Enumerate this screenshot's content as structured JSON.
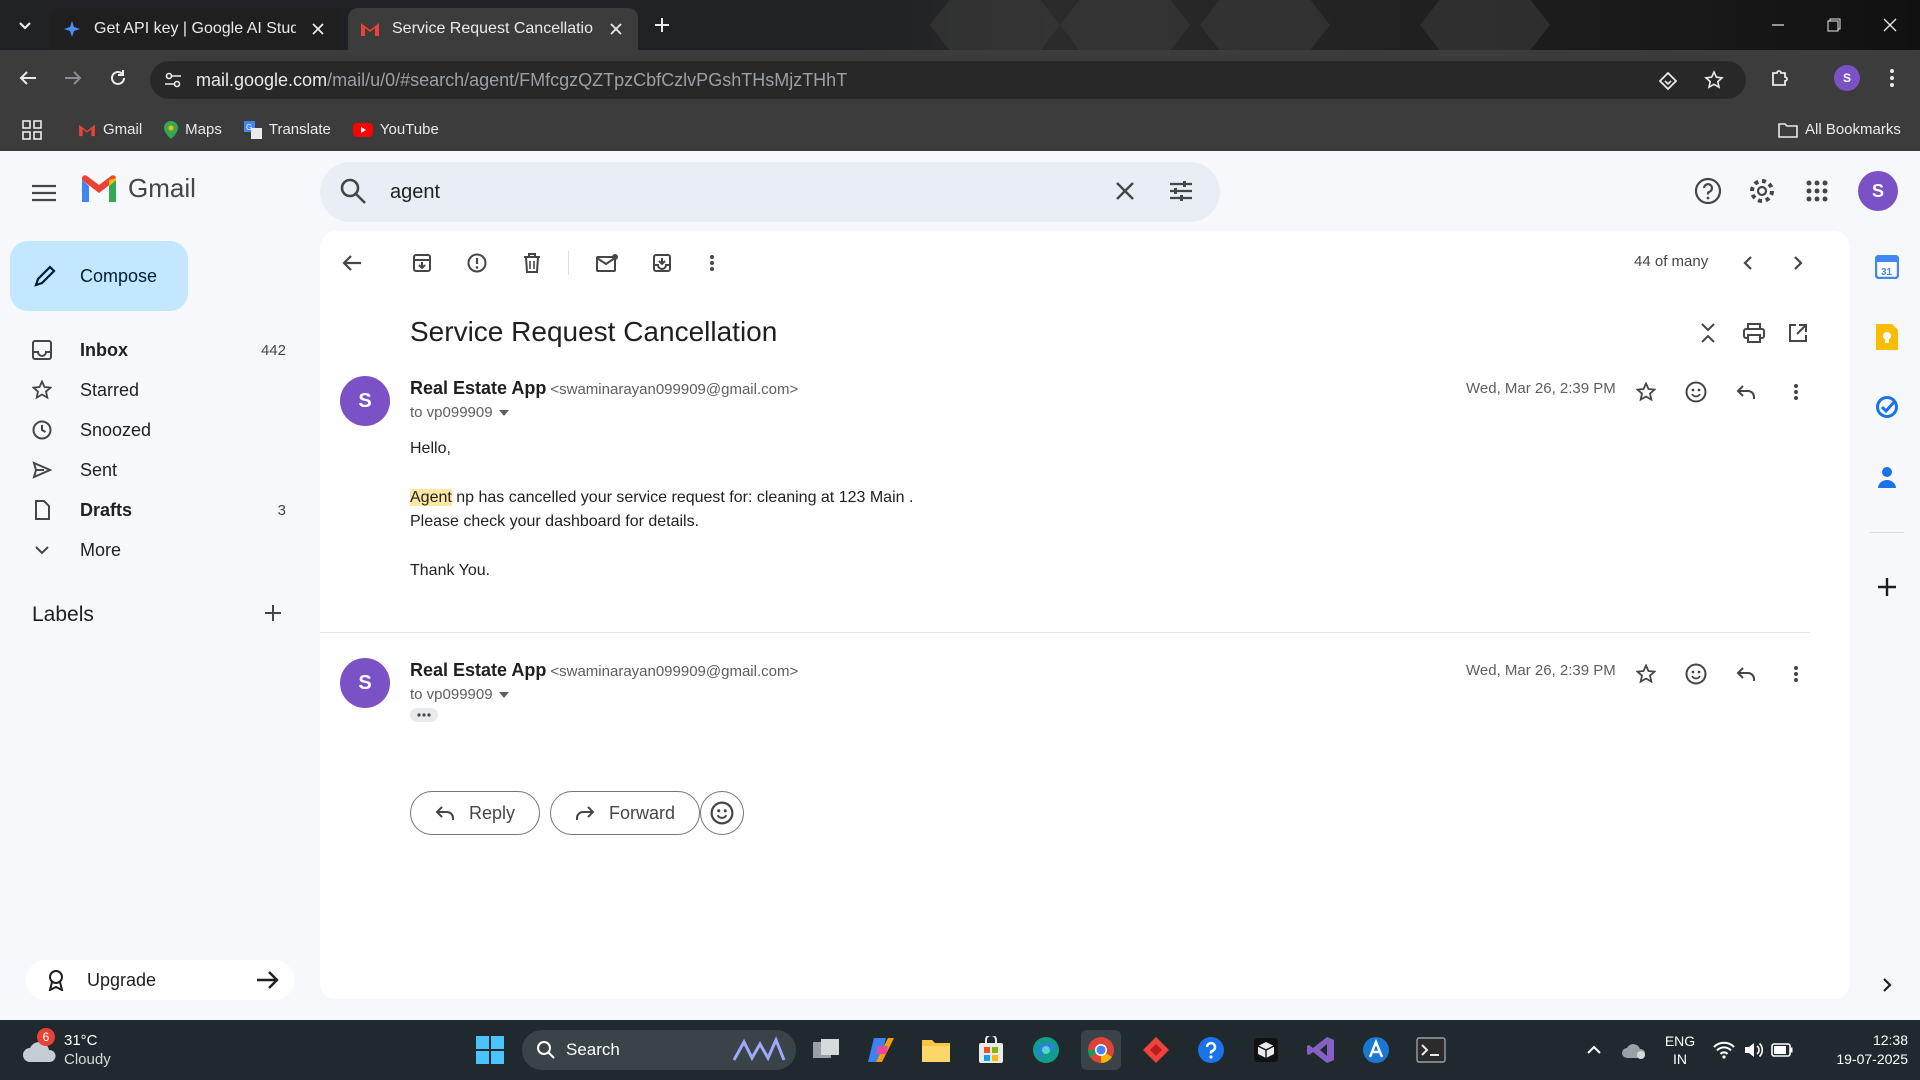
{
  "browser": {
    "tabs": [
      {
        "title": "Get API key | Google AI Studio"
      },
      {
        "title": "Service Request Cancellation - s"
      }
    ],
    "url_host": "mail.google.com",
    "url_path": "/mail/u/0/#search/agent/FMfcgzQZTpzCbfCzlvPGshTHsMjzTHhT",
    "profile_initial": "S",
    "bookmarks": [
      {
        "label": "Gmail"
      },
      {
        "label": "Maps"
      },
      {
        "label": "Translate"
      },
      {
        "label": "YouTube"
      }
    ],
    "all_bookmarks": "All Bookmarks"
  },
  "gmail": {
    "brand": "Gmail",
    "search_value": "agent",
    "avatar_initial": "S",
    "compose_label": "Compose",
    "nav": [
      {
        "label": "Inbox",
        "count": "442"
      },
      {
        "label": "Starred",
        "count": ""
      },
      {
        "label": "Snoozed",
        "count": ""
      },
      {
        "label": "Sent",
        "count": ""
      },
      {
        "label": "Drafts",
        "count": "3"
      },
      {
        "label": "More",
        "count": ""
      }
    ],
    "labels_heading": "Labels",
    "upgrade_label": "Upgrade"
  },
  "thread": {
    "pager": "44 of many",
    "subject": "Service Request Cancellation",
    "messages": [
      {
        "sender_initial": "S",
        "sender": "Real Estate App",
        "email": "<swaminarayan099909@gmail.com>",
        "to": "to vp099909",
        "date": "Wed, Mar 26, 2:39 PM",
        "lines": {
          "greeting": "Hello,",
          "highlight": "Agent",
          "line1_rest": " np has cancelled your service request for: cleaning at 123 Main .",
          "line2": "Please check your dashboard for details.",
          "signoff": "Thank You."
        }
      },
      {
        "sender_initial": "S",
        "sender": "Real Estate App",
        "email": "<swaminarayan099909@gmail.com>",
        "to": "to vp099909",
        "date": "Wed, Mar 26, 2:39 PM"
      }
    ],
    "reply_label": "Reply",
    "forward_label": "Forward"
  },
  "taskbar": {
    "weather_badge": "6",
    "temp": "31°C",
    "condition": "Cloudy",
    "search_label": "Search",
    "lang1": "ENG",
    "lang2": "IN",
    "time": "12:38",
    "date": "19-07-2025"
  },
  "colors": {
    "accent": "#0b57d0",
    "avatar": "#7b52c6",
    "compose_bg": "#c2e7ff",
    "highlight": "#fce8a2"
  }
}
